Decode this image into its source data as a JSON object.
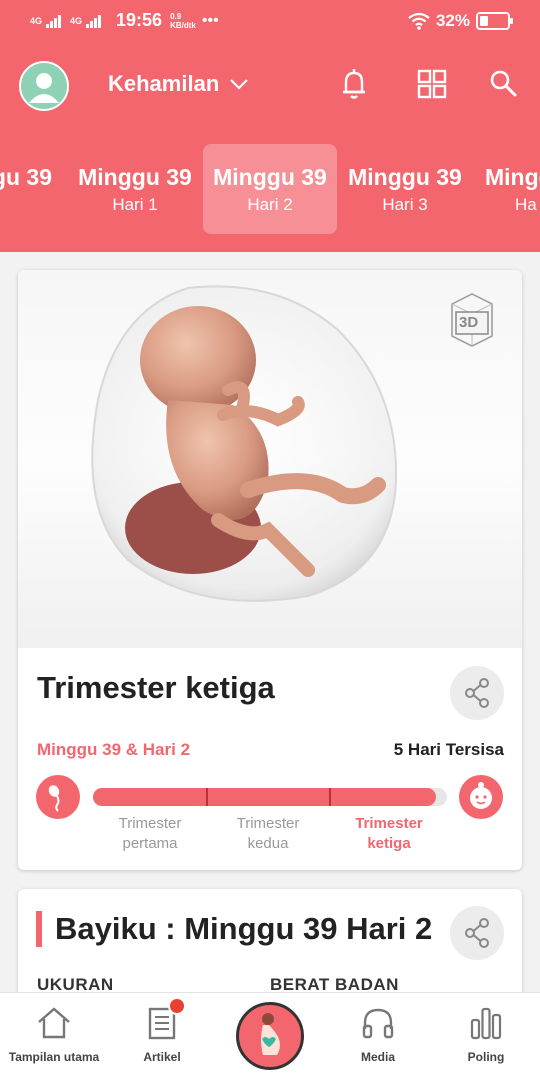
{
  "colors": {
    "brand": "#f4666e",
    "text": "#222222",
    "muted": "#999999"
  },
  "status_bar": {
    "network_1": "4G",
    "network_2": "4G",
    "time": "19:56",
    "speed_value": "0.9",
    "speed_unit": "KB/dtk",
    "more": "•••",
    "battery": "32%",
    "battery_level": 0.32
  },
  "header": {
    "title": "Kehamilan",
    "icons": [
      "avatar-icon",
      "chevron-down-icon",
      "bell-icon",
      "grid-icon",
      "search-icon"
    ]
  },
  "week_strip": [
    {
      "week": "gu 39",
      "day": ""
    },
    {
      "week": "Minggu 39",
      "day": "Hari 1"
    },
    {
      "week": "Minggu 39",
      "day": "Hari 2",
      "selected": true
    },
    {
      "week": "Minggu 39",
      "day": "Hari 3"
    },
    {
      "week": "Mingg",
      "day": "Ha"
    }
  ],
  "trimester_card": {
    "badge_3d": "3D",
    "title": "Trimester ketiga",
    "position": "Minggu 39 & Hari 2",
    "remaining": "5 Hari Tersisa",
    "progress": 0.97,
    "segments": [
      {
        "line1": "Trimester",
        "line2": "pertama",
        "current": false
      },
      {
        "line1": "Trimester",
        "line2": "kedua",
        "current": false
      },
      {
        "line1": "Trimester",
        "line2": "ketiga",
        "current": true
      }
    ]
  },
  "baby_card": {
    "title": "Bayiku : Minggu 39 Hari 2",
    "stat_1": "UKURAN",
    "stat_2": "BERAT BADAN"
  },
  "bottom_nav": [
    {
      "label": "Tampilan utama",
      "icon": "home-icon"
    },
    {
      "label": "Artikel",
      "icon": "article-icon",
      "has_badge": true
    },
    {
      "label": "",
      "icon": "pregnancy-icon"
    },
    {
      "label": "Media",
      "icon": "headphones-icon"
    },
    {
      "label": "Poling",
      "icon": "poll-icon"
    }
  ]
}
